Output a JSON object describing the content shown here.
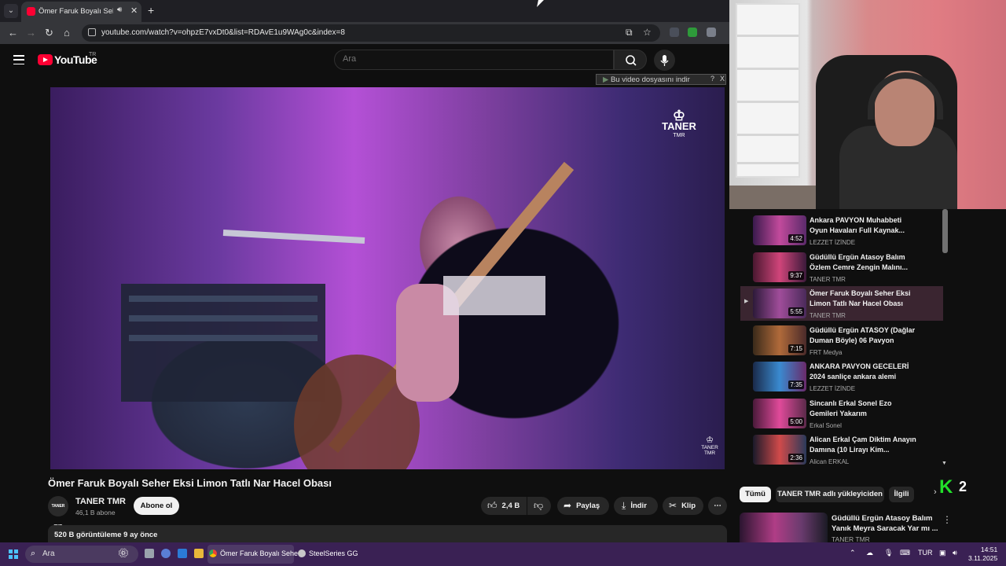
{
  "browser": {
    "tab_title": "Ömer Faruk Boyalı Seher Eksi Limon Tatlı Nar Hacel Obası - YouTube",
    "url": "youtube.com/watch?v=ohpzE7vxDt0&list=RDAvE1u9WAg0c&index=8"
  },
  "masthead": {
    "logo_text": "YouTube",
    "region": "TR",
    "search_placeholder": "Ara"
  },
  "download_bar": {
    "label": "Bu video dosyasını indir",
    "help": "?",
    "close": "X"
  },
  "player": {
    "watermark_top": "TANER",
    "watermark_top_sub": "TMR",
    "watermark_bottom": "TANER TMR"
  },
  "video": {
    "title": "Ömer Faruk Boyalı Seher Eksi Limon Tatlı Nar Hacel Obası",
    "channel_name": "TANER TMR",
    "channel_avatar": "TANER TMR",
    "subscribers": "46,1 B abone",
    "subscribe_label": "Abone ol",
    "like_count": "2,4 B",
    "share_label": "Paylaş",
    "download_label": "İndir",
    "clip_label": "Klip",
    "more_label": "⋯",
    "view_stats": "520 B görüntüleme  9 ay önce"
  },
  "playlist": [
    {
      "title": "Ankara PAVYON Muhabbeti Oyun Havaları Full Kaynak...",
      "channel": "LEZZET İZİNDE",
      "duration": "4:52",
      "active": false
    },
    {
      "title": "Güdüllü Ergün Atasoy Balım Özlem Cemre Zengin Malını...",
      "channel": "TANER TMR",
      "duration": "9:37",
      "active": false
    },
    {
      "title": "Ömer Faruk Boyalı Seher Eksi Limon Tatlı Nar Hacel Obası",
      "channel": "TANER TMR",
      "duration": "5:55",
      "active": true
    },
    {
      "title": "Güdüllü Ergün ATASOY (Dağlar Duman Böyle) 06 Pavyon",
      "channel": "FRT Medya",
      "duration": "7:15",
      "active": false
    },
    {
      "title": "ANKARA PAVYON GECELERİ 2024 sanliçe ankara alemi",
      "channel": "LEZZET İZİNDE",
      "duration": "7:35",
      "active": false
    },
    {
      "title": "Sincanlı Erkal Sonel Ezo Gemileri Yakarım",
      "channel": "Erkal Sonel",
      "duration": "5:00",
      "active": false
    },
    {
      "title": "Alican Erkal Çam Diktim Anayın Damına (10 Lirayı Kim...",
      "channel": "Alican ERKAL",
      "duration": "2:36",
      "active": false
    }
  ],
  "chips": [
    "Tümü",
    "TANER TMR adlı yükleyiciden",
    "İlgili"
  ],
  "overlay": {
    "k_logo": "K",
    "k_count": "2"
  },
  "recommendation": {
    "title": "Güdüllü Ergün Atasoy Balım Yanık Meyra Saracak Yar mı ...",
    "channel": "TANER TMR"
  },
  "taskbar": {
    "search_label": "Ara",
    "chrome_label": "Ömer Faruk Boyalı Sehe",
    "steelseries_label": "SteelSeries GG",
    "language": "TUR",
    "time": "14:51",
    "date": "3.11.2025"
  },
  "colors": {
    "youtube_red": "#ff0033",
    "kick_green": "#22e02a",
    "taskbar": "#3a2154"
  }
}
